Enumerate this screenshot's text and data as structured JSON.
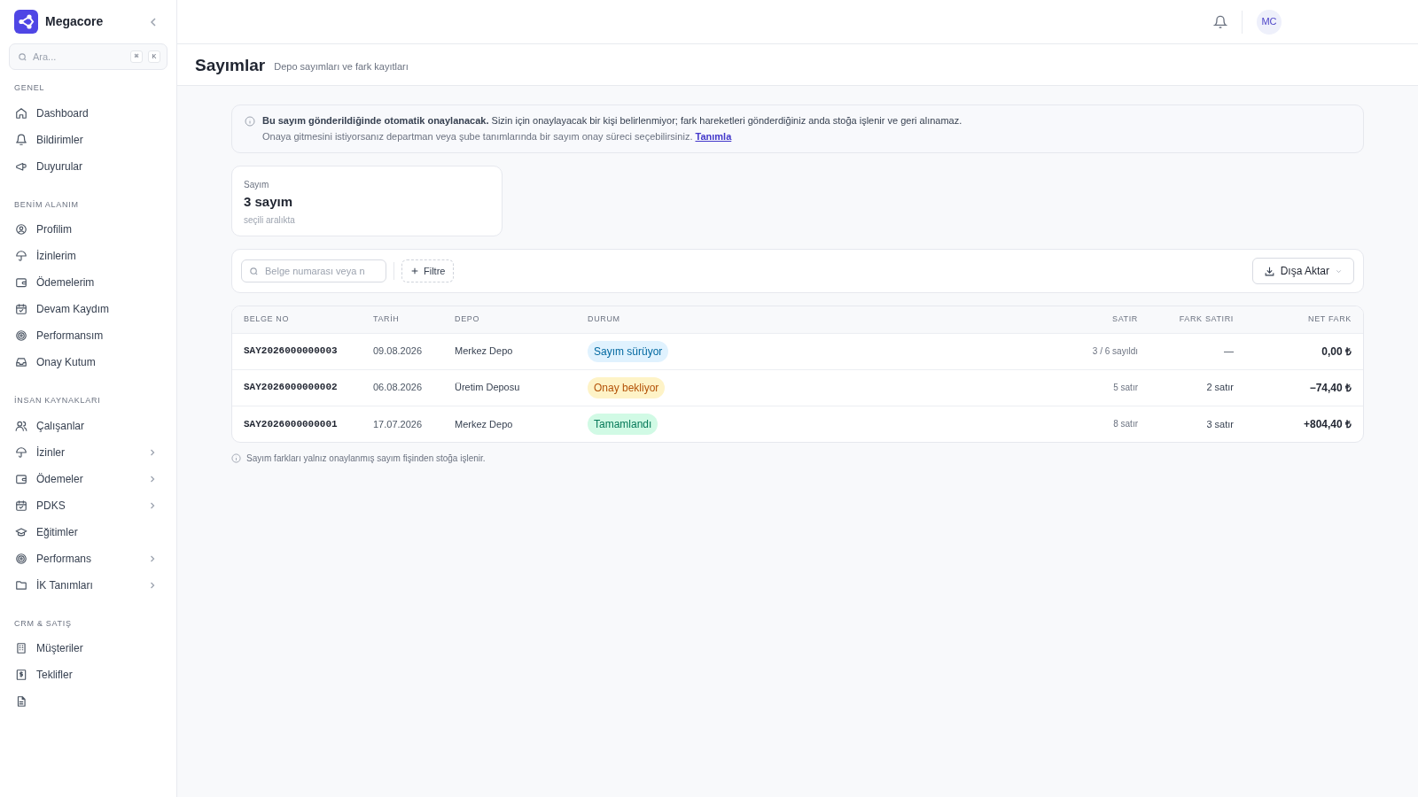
{
  "sidebar": {
    "brand": "Megacore",
    "search": {
      "placeholder": "Ara...",
      "keys": [
        "⌘",
        "K"
      ]
    },
    "sections": [
      {
        "title": "GENEL",
        "items": [
          {
            "label": "Dashboard",
            "expandable": false
          },
          {
            "label": "Bildirimler",
            "expandable": false
          },
          {
            "label": "Duyurular",
            "expandable": false
          }
        ]
      },
      {
        "title": "BENİM ALANIM",
        "items": [
          {
            "label": "Profilim",
            "expandable": false
          },
          {
            "label": "İzinlerim",
            "expandable": false
          },
          {
            "label": "Ödemelerim",
            "expandable": false
          },
          {
            "label": "Devam Kaydım",
            "expandable": false
          },
          {
            "label": "Performansım",
            "expandable": false
          },
          {
            "label": "Onay Kutum",
            "expandable": false
          }
        ]
      },
      {
        "title": "İNSAN KAYNAKLARI",
        "items": [
          {
            "label": "Çalışanlar",
            "expandable": false
          },
          {
            "label": "İzinler",
            "expandable": true
          },
          {
            "label": "Ödemeler",
            "expandable": true
          },
          {
            "label": "PDKS",
            "expandable": true
          },
          {
            "label": "Eğitimler",
            "expandable": false
          },
          {
            "label": "Performans",
            "expandable": true
          },
          {
            "label": "İK Tanımları",
            "expandable": true
          }
        ]
      },
      {
        "title": "CRM & SATIŞ",
        "items": [
          {
            "label": "Müşteriler",
            "expandable": false
          },
          {
            "label": "Teklifler",
            "expandable": false
          }
        ]
      }
    ]
  },
  "topbar": {
    "avatar": "MC"
  },
  "page": {
    "title": "Sayımlar",
    "subtitle": "Depo sayımları ve fark kayıtları"
  },
  "notice": {
    "text": "**Bu sayım gönderildiğinde otomatik onaylanacak.** Sizin için onaylayacak bir kişi belirlenmiyor; fark hareketleri gönderdiğiniz anda stoğa işlenir ve geri alınamaz.",
    "text2": "Onaya gitmesini istiyorsanız departman veya şube tanımlarında bir sayım onay süreci seçebilirsiniz.",
    "link": "Tanımla"
  },
  "stat": {
    "label": "Sayım",
    "value": "3 sayım",
    "caption": "seçili aralıkta"
  },
  "toolbar": {
    "search_placeholder": "Belge numarası veya n",
    "filter": "Filtre",
    "export": "Dışa Aktar"
  },
  "table": {
    "columns": [
      "BELGE NO",
      "TARİH",
      "DEPO",
      "DURUM",
      "SATIR",
      "FARK SATIRI",
      "NET FARK"
    ],
    "rows": [
      {
        "doc": "SAY2026000000003",
        "date": "09.08.2026",
        "depot": "Merkez Depo",
        "status": "Sayım sürüyor",
        "kind": "progress",
        "lines": "3 / 6 sayıldı",
        "diff_lines": "—",
        "net": "0,00 ₺"
      },
      {
        "doc": "SAY2026000000002",
        "date": "06.08.2026",
        "depot": "Üretim Deposu",
        "status": "Onay bekliyor",
        "kind": "pending",
        "lines": "5 satır",
        "diff_lines": "2 satır",
        "net": "−74,40 ₺"
      },
      {
        "doc": "SAY2026000000001",
        "date": "17.07.2026",
        "depot": "Merkez Depo",
        "status": "Tamamlandı",
        "kind": "done",
        "lines": "8 satır",
        "diff_lines": "3 satır",
        "net": "+804,40 ₺"
      }
    ]
  },
  "footnote": "Sayım farkları yalnız onaylanmış sayım fişinden stoğa işlenir."
}
